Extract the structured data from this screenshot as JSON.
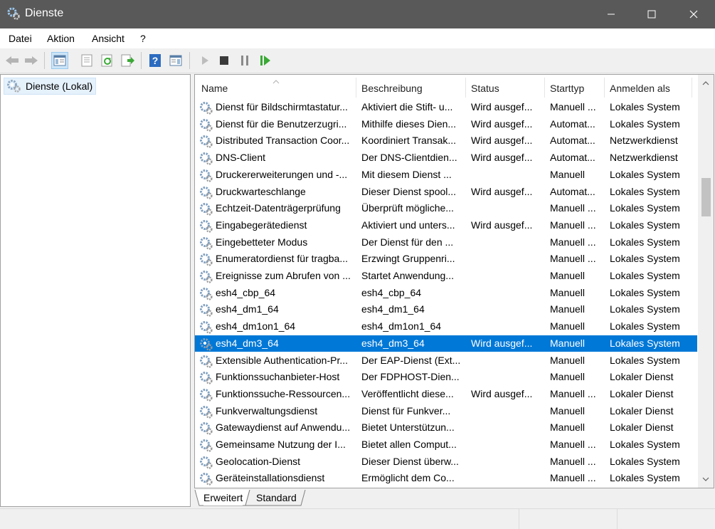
{
  "window": {
    "title": "Dienste"
  },
  "menu": [
    "Datei",
    "Aktion",
    "Ansicht",
    "?"
  ],
  "tree": {
    "root_label": "Dienste (Lokal)"
  },
  "columns": [
    "Name",
    "Beschreibung",
    "Status",
    "Starttyp",
    "Anmelden als"
  ],
  "rows": [
    [
      "Dienst für Bildschirmtastatur...",
      "Aktiviert die Stift- u...",
      "Wird ausgef...",
      "Manuell ...",
      "Lokales System"
    ],
    [
      "Dienst für die Benutzerzugri...",
      "Mithilfe dieses Dien...",
      "Wird ausgef...",
      "Automat...",
      "Lokales System"
    ],
    [
      "Distributed Transaction Coor...",
      "Koordiniert Transak...",
      "Wird ausgef...",
      "Automat...",
      "Netzwerkdienst"
    ],
    [
      "DNS-Client",
      "Der DNS-Clientdien...",
      "Wird ausgef...",
      "Automat...",
      "Netzwerkdienst"
    ],
    [
      "Druckererweiterungen und -...",
      "Mit diesem Dienst ...",
      "",
      "Manuell",
      "Lokales System"
    ],
    [
      "Druckwarteschlange",
      "Dieser Dienst spool...",
      "Wird ausgef...",
      "Automat...",
      "Lokales System"
    ],
    [
      "Echtzeit-Datenträgerprüfung",
      "Überprüft mögliche...",
      "",
      "Manuell ...",
      "Lokales System"
    ],
    [
      "Eingabegerätedienst",
      "Aktiviert und unters...",
      "Wird ausgef...",
      "Manuell ...",
      "Lokales System"
    ],
    [
      "Eingebetteter Modus",
      "Der Dienst für den ...",
      "",
      "Manuell ...",
      "Lokales System"
    ],
    [
      "Enumeratordienst für tragba...",
      "Erzwingt Gruppenri...",
      "",
      "Manuell ...",
      "Lokales System"
    ],
    [
      "Ereignisse zum Abrufen von ...",
      "Startet Anwendung...",
      "",
      "Manuell",
      "Lokales System"
    ],
    [
      "esh4_cbp_64",
      "esh4_cbp_64",
      "",
      "Manuell",
      "Lokales System"
    ],
    [
      "esh4_dm1_64",
      "esh4_dm1_64",
      "",
      "Manuell",
      "Lokales System"
    ],
    [
      "esh4_dm1on1_64",
      "esh4_dm1on1_64",
      "",
      "Manuell",
      "Lokales System"
    ],
    [
      "esh4_dm3_64",
      "esh4_dm3_64",
      "Wird ausgef...",
      "Manuell",
      "Lokales System"
    ],
    [
      "Extensible Authentication-Pr...",
      "Der EAP-Dienst (Ext...",
      "",
      "Manuell",
      "Lokales System"
    ],
    [
      "Funktionssuchanbieter-Host",
      "Der FDPHOST-Dien...",
      "",
      "Manuell",
      "Lokaler Dienst"
    ],
    [
      "Funktionssuche-Ressourcen...",
      "Veröffentlicht diese...",
      "Wird ausgef...",
      "Manuell ...",
      "Lokaler Dienst"
    ],
    [
      "Funkverwaltungsdienst",
      "Dienst für Funkver...",
      "",
      "Manuell",
      "Lokaler Dienst"
    ],
    [
      "Gatewaydienst auf Anwendu...",
      "Bietet Unterstützun...",
      "",
      "Manuell",
      "Lokaler Dienst"
    ],
    [
      "Gemeinsame Nutzung der I...",
      "Bietet allen Comput...",
      "",
      "Manuell ...",
      "Lokales System"
    ],
    [
      "Geolocation-Dienst",
      "Dieser Dienst überw...",
      "",
      "Manuell ...",
      "Lokales System"
    ],
    [
      "Geräteinstallationsdienst",
      "Ermöglicht dem Co...",
      "",
      "Manuell ...",
      "Lokales System"
    ]
  ],
  "selected_row": 14,
  "tabs": [
    "Erweitert",
    "Standard"
  ],
  "colors": {
    "selection": "#0078d7",
    "titlebar": "#595959"
  }
}
